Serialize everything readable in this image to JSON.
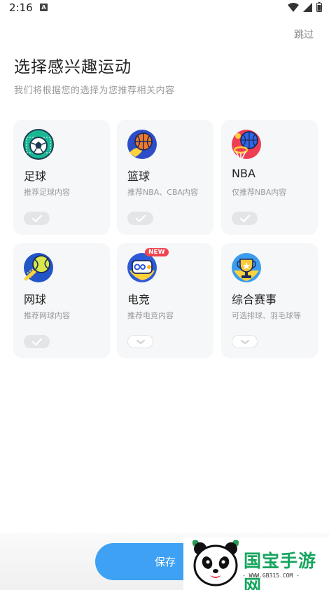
{
  "status": {
    "time": "2:16",
    "notif_badge": "A"
  },
  "header": {
    "skip_label": "跳过",
    "title": "选择感兴趣运动",
    "subtitle": "我们将根据您的选择为您推荐相关内容"
  },
  "cards": [
    {
      "name": "足球",
      "desc": "推荐足球内容",
      "icon": "soccer-icon",
      "selected": true
    },
    {
      "name": "篮球",
      "desc": "推荐NBA、CBA内容",
      "icon": "basketball-icon",
      "selected": true
    },
    {
      "name": "NBA",
      "desc": "仅推荐NBA内容",
      "icon": "nba-icon",
      "selected": true
    },
    {
      "name": "网球",
      "desc": "推荐网球内容",
      "icon": "tennis-icon",
      "selected": true
    },
    {
      "name": "电竞",
      "desc": "推荐电竞内容",
      "icon": "esports-icon",
      "selected": false,
      "badge": "NEW"
    },
    {
      "name": "综合赛事",
      "desc": "可选排球、羽毛球等",
      "icon": "trophy-icon",
      "selected": false
    }
  ],
  "footer": {
    "save_label": "保存"
  },
  "watermark": {
    "brand": "国宝手游网",
    "url": "- WWW.GB315.COM -"
  },
  "colors": {
    "accent": "#3ea1f4",
    "badge": "#f0444e",
    "watermark_green": "#17a55f"
  }
}
